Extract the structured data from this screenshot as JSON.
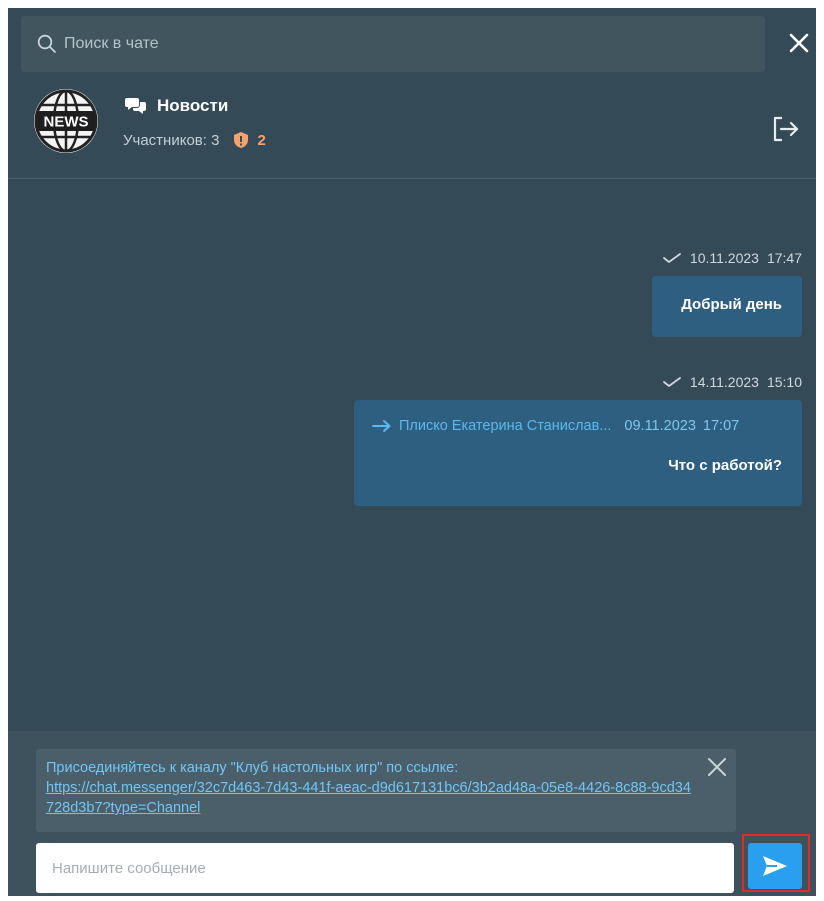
{
  "search": {
    "placeholder": "Поиск в чате"
  },
  "chat": {
    "title": "Новости",
    "avatar_text": "NEWS",
    "members_label": "Участников: 3",
    "admins_count": "2"
  },
  "messages": [
    {
      "date": "10.11.2023",
      "time": "17:47",
      "text": "Добрый день",
      "status": "sent"
    },
    {
      "date": "14.11.2023",
      "time": "15:10",
      "forwarded_from": "Плиско Екатерина Станислав...",
      "forwarded_date": "09.11.2023",
      "forwarded_time": "17:07",
      "text": "Что с работой?",
      "status": "sent"
    }
  ],
  "invite_notice": {
    "text": "Присоединяйтесь к каналу \"Клуб настольных игр\" по ссылке:",
    "link": "https://chat.messenger/32c7d463-7d43-441f-aeac-d9d617131bc6/3b2ad48a-05e8-4426-8c88-9cd34728d3b7?type=Channel"
  },
  "composer": {
    "placeholder": "Напишите сообщение",
    "value": ""
  },
  "icons": {
    "search": "search-icon",
    "close": "close-icon",
    "chat": "chat-bubbles-icon",
    "shield": "shield-alert-icon",
    "exit": "exit-icon",
    "check": "check-icon",
    "forward": "forward-arrow-icon",
    "send": "send-icon"
  },
  "colors": {
    "background": "#354a57",
    "bubble": "#2f5f80",
    "accent": "#2a9ff0",
    "link": "#70c6f6",
    "admin_badge": "#f5a26b",
    "highlight": "#e02b2b"
  }
}
